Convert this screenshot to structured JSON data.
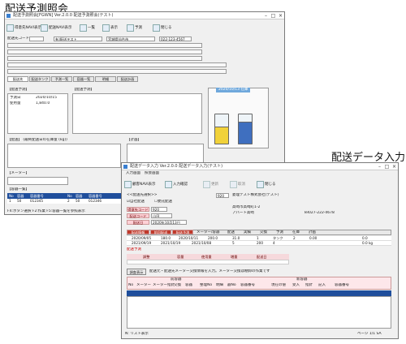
{
  "captions": {
    "top": "配送予測照会",
    "mid": "配送データ入力"
  },
  "back": {
    "title": "配送予測照会[FGWN] Ver.2.0.0 配送予測照会(テスト)",
    "toolbar": [
      "得意先NAVI表示",
      "配送NAVI表示",
      "一覧",
      "表示",
      "予測",
      "閉じる"
    ],
    "header_label": "配送先コード",
    "customer_name": "有)配送テスト",
    "address": "宮城県仙台市",
    "tel": "022-123-4567",
    "tabs": [
      "配送先",
      "配送タンク",
      "予測一覧",
      "容器一覧",
      "明細",
      "配送計画"
    ],
    "section_left": "【配送予測】",
    "section_mid": "【配送予測】",
    "section_delivery": "【配送】 (最終配送日の在庫量 (kg))",
    "section_plan": "【計画】",
    "section_meter": "【メーター】",
    "section_container": "【容器一覧】",
    "table_headers": [
      "No",
      "容器",
      "容器番号",
      "No",
      "容器",
      "容器番号"
    ],
    "rows": [
      [
        "1",
        "50",
        "012345",
        "2",
        "50",
        "012346"
      ]
    ],
    "graph_title": "2020/10/13 在庫",
    "tanks": [
      {
        "name": "A"
      },
      {
        "name": "B"
      }
    ],
    "values": [
      {
        "label": "予測日",
        "value": "2020/10/15"
      },
      {
        "label": "使用量",
        "value": "1,840.0"
      }
    ],
    "status": "F4:ボタン選択 F2:作業 F5:容器一覧を参照表示"
  },
  "front": {
    "title": "配送データ入力 Ver.2.0.0 配送データ入力(テスト)",
    "toolbar": [
      "顧客NAVI表示",
      "入力確認",
      "更新",
      "取消",
      "閉じる"
    ],
    "menu": [
      "入力画面",
      "照会画面"
    ],
    "selector_title": "<<配送先選択>>",
    "radio": [
      "自社配送",
      "委託配送"
    ],
    "fields": [
      {
        "label": "得意先コード",
        "value": "920"
      },
      {
        "label": "配送コード",
        "value": "山田"
      },
      {
        "label": "配送日",
        "value": "2020年10月13日"
      }
    ],
    "customer": {
      "code": "920",
      "name": "菱理テスト株式会社(テスト)",
      "addr": "高崎市高崎町1-2",
      "bld": "アパート高崎",
      "tel": "Tel027-222-4678"
    },
    "tabs": [
      "配送情報",
      "前回配送",
      "配送予測",
      "メーター/容器",
      "配送",
      "実績",
      "交換",
      "予測",
      "在庫",
      "計画"
    ],
    "grid_rows": [
      [
        "2020/09/05",
        "180.0",
        "2020/10/11",
        "200.0",
        "31.0",
        "1",
        "タンク",
        "2",
        "0.00",
        "0.0"
      ],
      [
        "2021/09/19",
        "2021/10/19",
        "2021/10/08",
        "",
        "5",
        "200",
        "4",
        "",
        "",
        "0.0 kg"
      ]
    ],
    "sub_label": "配送予測",
    "sub_headers": [
      "調整",
      "容量",
      "使用量",
      "増量",
      "配送日"
    ],
    "exchange_label": "調査表示",
    "exchange_note": "配送元・配送先メーター交換情報を入力。メーター交換は棚卸の作業です",
    "exch_headers": [
      "No",
      "メーター",
      "メーター指針",
      "交換",
      "容器",
      "整理No",
      "明細",
      "器No",
      "容器番号",
      "現在の値",
      "受入",
      "指針",
      "記入",
      "容器番号"
    ],
    "exch_group": [
      "前容器",
      "新容器"
    ],
    "status_left": "N: リスト表示",
    "status_right": "ページ 1/1 SA"
  }
}
